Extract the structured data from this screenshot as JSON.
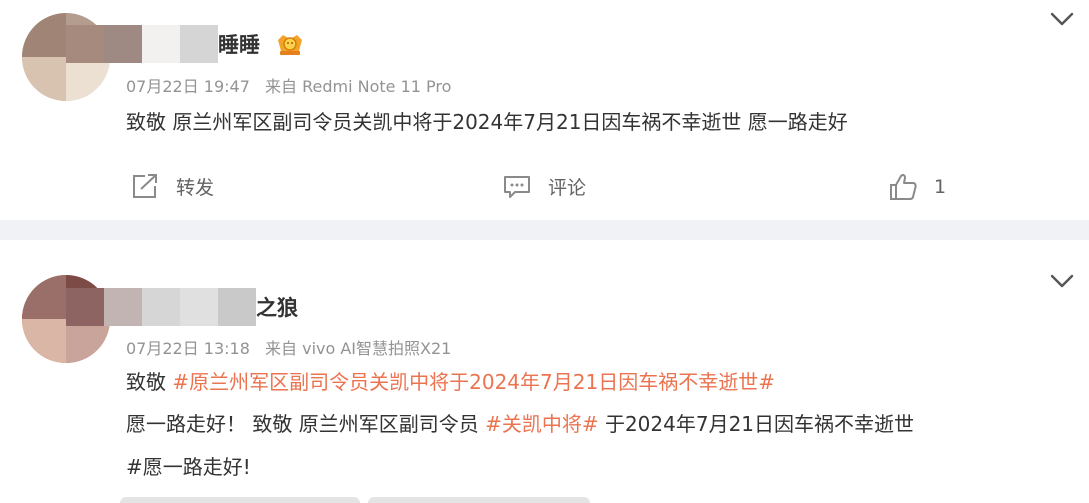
{
  "posts": [
    {
      "username_visible": "睡睡",
      "date": "07月22日 19:47",
      "source": "来自 Redmi Note 11 Pro",
      "content_line1": "致敬 原兰州军区副司令员关凯中将于2024年7月21日因车祸不幸逝世 愿一路走好",
      "actions": {
        "repost_label": "转发",
        "comment_label": "评论",
        "like_count": "1"
      }
    },
    {
      "username_visible": "之狼",
      "date": "07月22日 13:18",
      "source": "来自 vivo AI智慧拍照X21",
      "line1_prefix": "致敬 ",
      "line1_tag": "#原兰州军区副司令员关凯中将于2024年7月21日因车祸不幸逝世#",
      "line2_prefix": "愿一路走好！ 致敬 原兰州军区副司令员 ",
      "line2_tag": "#关凯中将#",
      "line2_suffix": " 于2024年7月21日因车祸不幸逝世",
      "line3": "#愿一路走好!"
    }
  ],
  "colors": {
    "text": "#333333",
    "meta": "#939393",
    "hashtag": "#eb7350",
    "separator": "#f1f2f5",
    "action": "#636363"
  },
  "icons": [
    "chevron-down-icon",
    "vip-crown-badge-icon",
    "repost-icon",
    "comment-icon",
    "like-icon"
  ]
}
